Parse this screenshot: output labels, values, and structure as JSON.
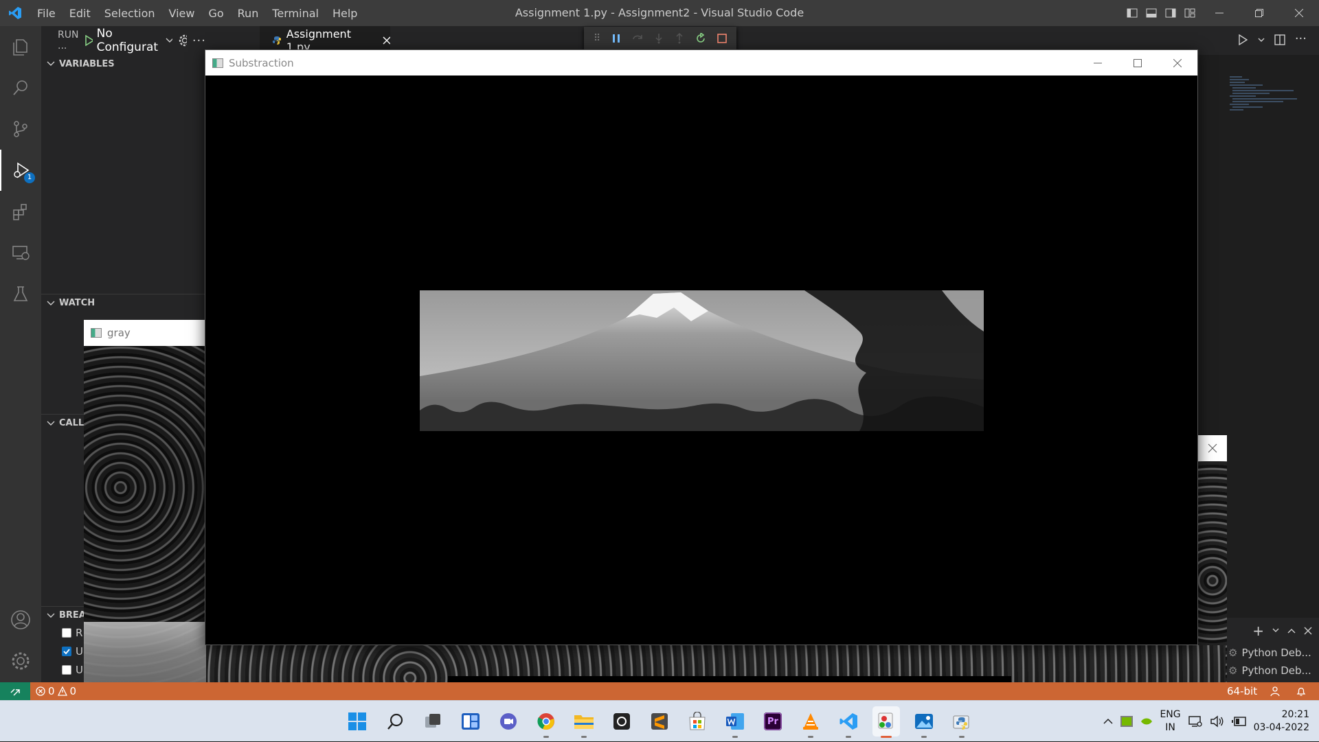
{
  "window_title": "Assignment 1.py - Assignment2 - Visual Studio Code",
  "menu": [
    "File",
    "Edit",
    "Selection",
    "View",
    "Go",
    "Run",
    "Terminal",
    "Help"
  ],
  "sidebar": {
    "run_label": "RUN ...",
    "config": "No Configurat",
    "sections": {
      "variables": "VARIABLES",
      "watch": "WATCH",
      "call_stack": "CALL :",
      "breakpoints": "BREAI"
    },
    "breakpoints": [
      {
        "label": "R",
        "checked": false
      },
      {
        "label": "U",
        "checked": true
      },
      {
        "label": "U",
        "checked": false
      }
    ]
  },
  "activity": {
    "debug_badge": "1"
  },
  "tab": {
    "label": "Assignment 1.py"
  },
  "windows": {
    "subtraction_title": "Substraction",
    "gray_title": "gray"
  },
  "panel": {
    "terminals": [
      "Python Deb...",
      "Python Deb..."
    ]
  },
  "status": {
    "errors": "0",
    "warnings": "0",
    "arch": "64-bit"
  },
  "tray": {
    "lang_top": "ENG",
    "lang_bottom": "IN",
    "time": "20:21",
    "date": "03-04-2022"
  },
  "colors": {
    "statusbar": "#cc6633",
    "remote": "#16825d",
    "accent": "#0e70c0",
    "activity": "#333333",
    "sidebar": "#252526",
    "titlebar": "#3c3c3c"
  }
}
